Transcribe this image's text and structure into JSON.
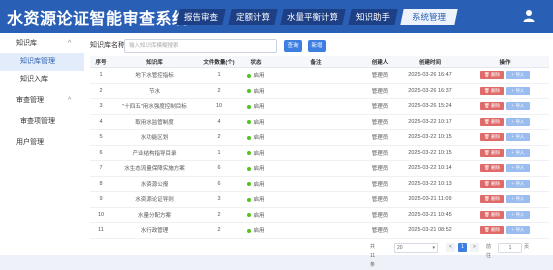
{
  "app": {
    "title": "水资源论证智能审查系统"
  },
  "nav": {
    "items": [
      {
        "label": "报告审查"
      },
      {
        "label": "定额计算"
      },
      {
        "label": "水量平衡计算"
      },
      {
        "label": "知识助手"
      },
      {
        "label": "系统管理"
      }
    ],
    "active": "系统管理"
  },
  "header": {
    "user_icon": "user-icon"
  },
  "sidebar": {
    "items": [
      {
        "label": "知识库",
        "chevron": "^"
      },
      {
        "label": "知识库管理"
      },
      {
        "label": "知识入库"
      },
      {
        "label": "审查管理",
        "chevron": "^"
      },
      {
        "label": "审查项管理"
      },
      {
        "label": "用户管理"
      }
    ]
  },
  "search": {
    "label": "知识库名称:",
    "placeholder": "输入知识库模糊搜索",
    "query_button": "查询",
    "add_button": "新增"
  },
  "table": {
    "headers": [
      "序号",
      "知识库",
      "文件数量(个)",
      "状态",
      "备注",
      "创建人",
      "创建时间",
      "操作"
    ],
    "rows": [
      {
        "no": "1",
        "name": "地下水管控指标",
        "count": "1",
        "status": "启用",
        "remark": "",
        "creator": "管理员",
        "time": "2025-03-26 16:47"
      },
      {
        "no": "2",
        "name": "节水",
        "count": "2",
        "status": "启用",
        "remark": "",
        "creator": "管理员",
        "time": "2025-03-26 16:37"
      },
      {
        "no": "3",
        "name": "\"十四五\"用水强度控制目标",
        "count": "10",
        "status": "启用",
        "remark": "",
        "creator": "管理员",
        "time": "2025-03-26 15:24"
      },
      {
        "no": "4",
        "name": "取用水监管制度",
        "count": "4",
        "status": "启用",
        "remark": "",
        "creator": "管理员",
        "time": "2025-03-22 10:17"
      },
      {
        "no": "5",
        "name": "水功能区划",
        "count": "2",
        "status": "启用",
        "remark": "",
        "creator": "管理员",
        "time": "2025-03-22 10:15"
      },
      {
        "no": "6",
        "name": "产业结构指导目录",
        "count": "1",
        "status": "启用",
        "remark": "",
        "creator": "管理员",
        "time": "2025-03-22 10:15"
      },
      {
        "no": "7",
        "name": "水生态流量保障实施方案",
        "count": "6",
        "status": "启用",
        "remark": "",
        "creator": "管理员",
        "time": "2025-03-22 10:14"
      },
      {
        "no": "8",
        "name": "水资源公报",
        "count": "6",
        "status": "启用",
        "remark": "",
        "creator": "管理员",
        "time": "2025-03-22 10:13"
      },
      {
        "no": "9",
        "name": "水资源论证导则",
        "count": "3",
        "status": "启用",
        "remark": "",
        "creator": "管理员",
        "time": "2025-03-21 11:09"
      },
      {
        "no": "10",
        "name": "水量分配方案",
        "count": "2",
        "status": "启用",
        "remark": "",
        "creator": "管理员",
        "time": "2025-03-21 10:45"
      },
      {
        "no": "11",
        "name": "水行政管理",
        "count": "2",
        "status": "启用",
        "remark": "",
        "creator": "管理员",
        "time": "2025-03-21 08:52"
      }
    ],
    "actions": {
      "delete": "删除",
      "import": "导入"
    },
    "status_color": "#52c41a"
  },
  "pagination": {
    "total": "共 11 条",
    "page_size": "20",
    "prev": "<",
    "current": "1",
    "next": ">",
    "goto_label": "前往",
    "goto_value": "1",
    "page_suffix": "页"
  },
  "colors": {
    "header": "#2a5fb6",
    "nav": "#1c3f86",
    "primary": "#3d7fe0",
    "danger": "#e06a6a"
  }
}
